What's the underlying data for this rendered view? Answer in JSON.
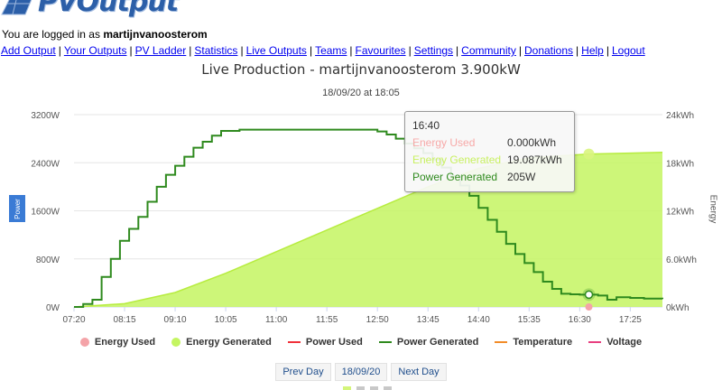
{
  "brand": {
    "name": "PVOutput",
    "color": "#2c5fa8"
  },
  "login": {
    "prefix": "You are logged in as",
    "user": "martijnvanoosterom"
  },
  "nav": [
    "Add Output",
    "Your Outputs",
    "PV Ladder",
    "Statistics",
    "Live Outputs",
    "Teams",
    "Favourites",
    "Settings",
    "Community",
    "Donations",
    "Help",
    "Logout"
  ],
  "header": {
    "title": "Live Production - martijnvanoosterom 3.900kW",
    "subtitle": "18/09/20 at 18:05"
  },
  "axis": {
    "left_title": "Power",
    "right_title": "Energy"
  },
  "tooltip": {
    "time": "16:40",
    "rows": [
      {
        "label": "Energy Used",
        "value": "0.000kWh",
        "color": "#f7a9a8"
      },
      {
        "label": "Energy Generated",
        "value": "19.087kWh",
        "color": "#c8f060"
      },
      {
        "label": "Power Generated",
        "value": "205W",
        "color": "#2f8a1e"
      }
    ]
  },
  "legend": [
    {
      "label": "Energy Used",
      "kind": "dot",
      "color": "#f4a3a8"
    },
    {
      "label": "Energy Generated",
      "kind": "dot",
      "color": "#c4f561"
    },
    {
      "label": "Power Used",
      "kind": "line",
      "color": "#f0313a"
    },
    {
      "label": "Power Generated",
      "kind": "line",
      "color": "#2f8a1e"
    },
    {
      "label": "Temperature",
      "kind": "line",
      "color": "#f28c28"
    },
    {
      "label": "Voltage",
      "kind": "line",
      "color": "#e83f7f"
    }
  ],
  "buttons": {
    "prev": "Prev Day",
    "date": "18/09/20",
    "next": "Next Day"
  },
  "chart_data": {
    "type": "line",
    "x_start": "07:20",
    "x_end": "18:00",
    "x_ticks": [
      "07:20",
      "08:15",
      "09:10",
      "10:05",
      "11:00",
      "11:55",
      "12:50",
      "13:45",
      "14:40",
      "15:35",
      "16:30",
      "17:25"
    ],
    "y_left": {
      "label": "Power",
      "ticks": [
        "0W",
        "800W",
        "1600W",
        "2400W",
        "3200W"
      ],
      "range": [
        0,
        3200
      ]
    },
    "y_right": {
      "label": "Energy",
      "ticks": [
        "0kWh",
        "6.0kWh",
        "12kWh",
        "18kWh",
        "24kWh"
      ],
      "range": [
        0,
        24
      ]
    },
    "series": [
      {
        "name": "Power Generated",
        "axis": "left",
        "color": "#2f8a1e",
        "points": [
          [
            "07:20",
            0
          ],
          [
            "07:30",
            50
          ],
          [
            "07:40",
            120
          ],
          [
            "07:50",
            500
          ],
          [
            "08:00",
            800
          ],
          [
            "08:10",
            1100
          ],
          [
            "08:20",
            1300
          ],
          [
            "08:30",
            1500
          ],
          [
            "08:40",
            1750
          ],
          [
            "08:50",
            2000
          ],
          [
            "09:00",
            2200
          ],
          [
            "09:10",
            2350
          ],
          [
            "09:20",
            2500
          ],
          [
            "09:30",
            2650
          ],
          [
            "09:40",
            2750
          ],
          [
            "09:50",
            2850
          ],
          [
            "10:00",
            2930
          ],
          [
            "10:20",
            2950
          ],
          [
            "11:00",
            2950
          ],
          [
            "11:55",
            2950
          ],
          [
            "12:30",
            2950
          ],
          [
            "12:50",
            2920
          ],
          [
            "13:00",
            2870
          ],
          [
            "13:10",
            2800
          ],
          [
            "13:20",
            2720
          ],
          [
            "13:30",
            2640
          ],
          [
            "13:40",
            2560
          ],
          [
            "13:50",
            2450
          ],
          [
            "14:00",
            2320
          ],
          [
            "14:10",
            2180
          ],
          [
            "14:20",
            2020
          ],
          [
            "14:30",
            1850
          ],
          [
            "14:40",
            1650
          ],
          [
            "14:50",
            1450
          ],
          [
            "15:00",
            1250
          ],
          [
            "15:10",
            1050
          ],
          [
            "15:20",
            880
          ],
          [
            "15:30",
            730
          ],
          [
            "15:40",
            580
          ],
          [
            "15:50",
            420
          ],
          [
            "16:00",
            300
          ],
          [
            "16:10",
            220
          ],
          [
            "16:20",
            210
          ],
          [
            "16:30",
            205
          ],
          [
            "16:40",
            205
          ],
          [
            "16:50",
            190
          ],
          [
            "17:00",
            120
          ],
          [
            "17:10",
            160
          ],
          [
            "17:25",
            150
          ],
          [
            "17:40",
            140
          ],
          [
            "18:00",
            130
          ]
        ]
      },
      {
        "name": "Energy Generated",
        "axis": "right",
        "color": "#c4f561",
        "points": [
          [
            "07:20",
            0
          ],
          [
            "08:15",
            0.4
          ],
          [
            "09:10",
            1.8
          ],
          [
            "10:05",
            4.2
          ],
          [
            "11:00",
            6.9
          ],
          [
            "11:55",
            9.6
          ],
          [
            "12:50",
            12.3
          ],
          [
            "13:45",
            15.0
          ],
          [
            "14:40",
            17.3
          ],
          [
            "15:35",
            18.6
          ],
          [
            "16:40",
            19.087
          ],
          [
            "17:25",
            19.2
          ],
          [
            "18:00",
            19.3
          ]
        ]
      },
      {
        "name": "Energy Used",
        "axis": "right",
        "color": "#f4a3a8",
        "points": [
          [
            "16:40",
            0
          ]
        ]
      }
    ]
  }
}
